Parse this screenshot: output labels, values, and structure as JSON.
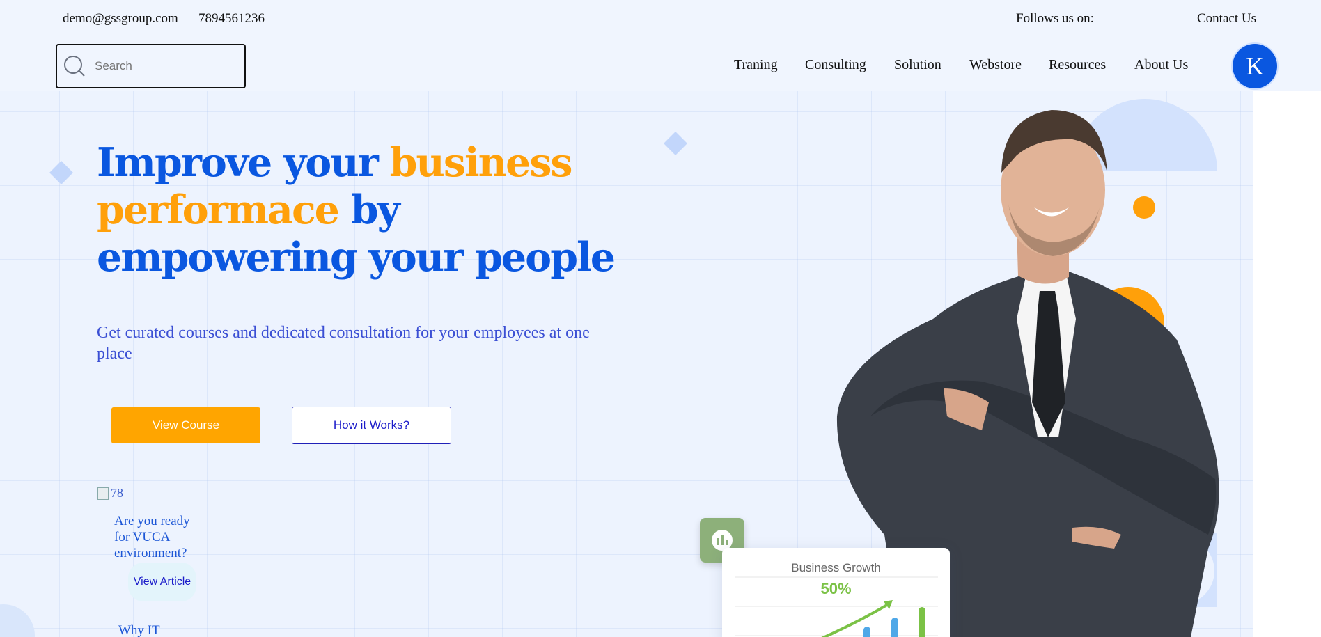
{
  "topbar": {
    "email": "demo@gssgroup.com",
    "phone": "7894561236",
    "follow_label": "Follows us on:",
    "contact": "Contact Us"
  },
  "search": {
    "placeholder": "Search"
  },
  "nav": {
    "items": [
      "Traning",
      "Consulting",
      "Solution",
      "Webstore",
      "Resources",
      "About Us"
    ]
  },
  "avatar": {
    "initial": "K"
  },
  "hero": {
    "headline_1": "Improve your ",
    "headline_2": "business",
    "headline_3": "performace",
    "headline_4": " by",
    "headline_5": "empowering your people",
    "subtitle": "Get curated courses and dedicated consultation for your employees at one place",
    "primary_button": "View Course",
    "secondary_button": "How it Works?"
  },
  "article": {
    "image_alt": "78",
    "title": "Are you ready for VUCA environment?",
    "button": "View Article",
    "next_title": "Why IT"
  },
  "growth_card": {
    "title": "Business Growth",
    "value": "50%"
  },
  "colors": {
    "brand_blue": "#0a57e0",
    "accent_orange": "#ffa500",
    "growth_green": "#7bc246",
    "bar_blue": "#4fa8e8"
  }
}
